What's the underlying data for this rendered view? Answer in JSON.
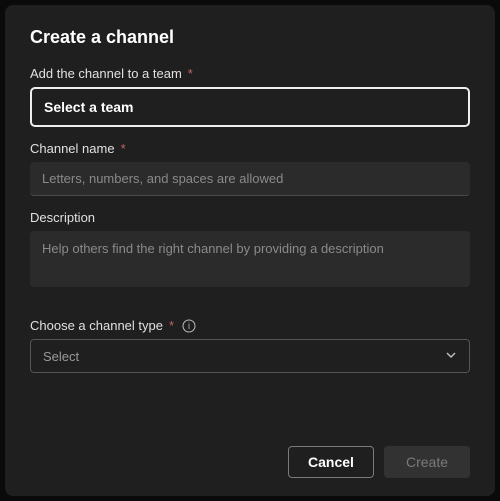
{
  "title": "Create a channel",
  "fields": {
    "team": {
      "label": "Add the channel to a team",
      "button_text": "Select a team",
      "required": true
    },
    "channel_name": {
      "label": "Channel name",
      "placeholder": "Letters, numbers, and spaces are allowed",
      "value": "",
      "required": true
    },
    "description": {
      "label": "Description",
      "placeholder": "Help others find the right channel by providing a description",
      "value": ""
    },
    "channel_type": {
      "label": "Choose a channel type",
      "selected": "Select",
      "required": true
    }
  },
  "required_marker": "*",
  "buttons": {
    "cancel": "Cancel",
    "create": "Create"
  }
}
